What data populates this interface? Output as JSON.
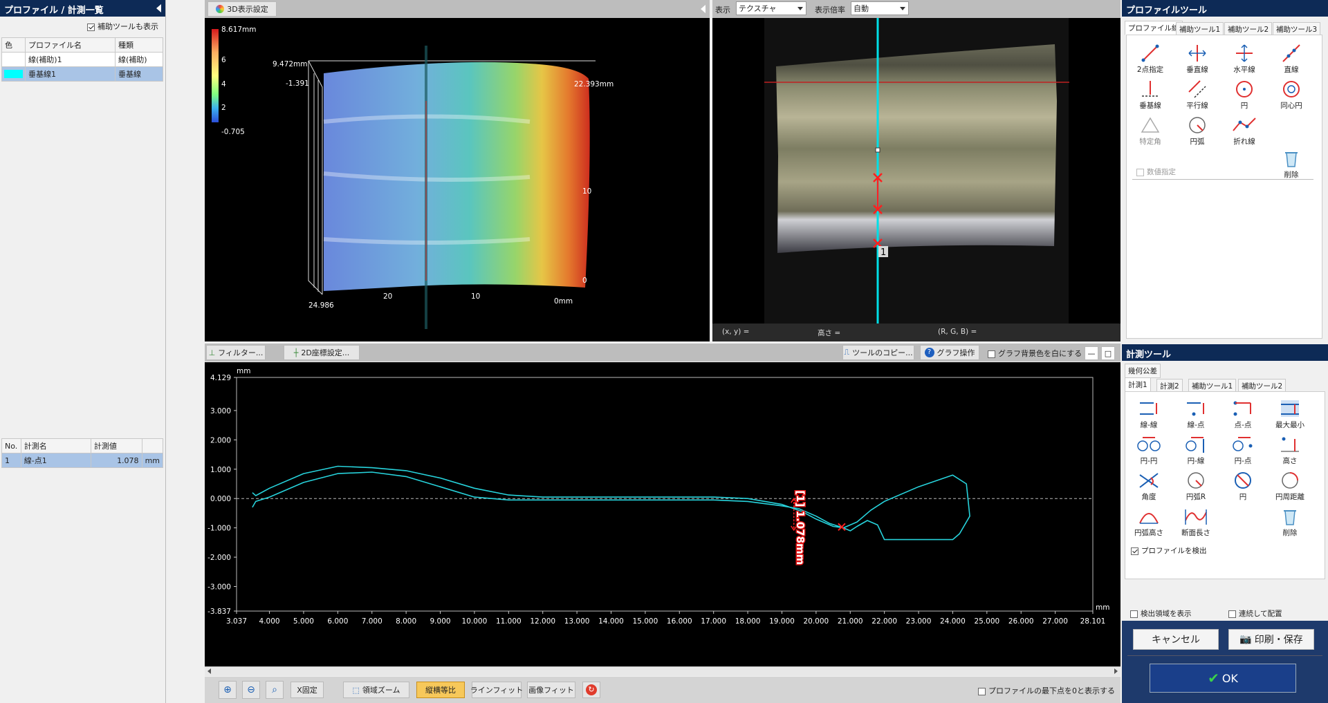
{
  "left_panel": {
    "title": "プロファイル / 計測一覧",
    "show_aux_label": "補助ツールも表示",
    "profile_table": {
      "headers": [
        "色",
        "プロファイル名",
        "種類"
      ],
      "rows": [
        {
          "color": "#ffffff",
          "name": "線(補助)1",
          "type": "線(補助)"
        },
        {
          "color": "#00ffff",
          "name": "垂基線1",
          "type": "垂基線"
        }
      ]
    },
    "measure_table": {
      "headers": [
        "No.",
        "計測名",
        "計測値",
        ""
      ],
      "rows": [
        {
          "no": "1",
          "name": "線-点1",
          "value": "1.078",
          "unit": "mm"
        }
      ]
    }
  },
  "view3d": {
    "button": "3D表示設定",
    "colorbar": {
      "max": "8.617mm",
      "ticks": [
        "6",
        "4",
        "2"
      ],
      "min": "-0.705"
    },
    "labels": {
      "top_left": "9.472mm",
      "minus": "-1.391",
      "right": "22.393mm",
      "bottom_left": "24.986",
      "x20": "20",
      "x10": "10",
      "x0": "0mm",
      "side10": "10",
      "side0": "0"
    }
  },
  "view2d": {
    "display_label": "表示",
    "display_value": "テクスチャ",
    "zoom_label": "表示倍率",
    "zoom_value": "自動",
    "marker_label": "1",
    "status": {
      "xy": "(x, y)  =",
      "height": "高さ  =",
      "rgb": "(R, G, B)  ="
    }
  },
  "graph_toolbar": {
    "filter": "フィルター...",
    "coord": "2D座標設定...",
    "copy_tool": "ツールのコピー...",
    "graph_op": "グラフ操作",
    "white_bg": "グラフ背景色を白にする"
  },
  "chart_data": {
    "type": "line",
    "yunit": "mm",
    "xunit": "mm",
    "xlim": [
      3.037,
      28.101
    ],
    "ylim": [
      -3.837,
      4.129
    ],
    "x_ticks": [
      "3.037",
      "4.000",
      "5.000",
      "6.000",
      "7.000",
      "8.000",
      "9.000",
      "10.000",
      "11.000",
      "12.000",
      "13.000",
      "14.000",
      "15.000",
      "16.000",
      "17.000",
      "18.000",
      "19.000",
      "20.000",
      "21.000",
      "22.000",
      "23.000",
      "24.000",
      "25.000",
      "26.000",
      "27.000",
      "28.101"
    ],
    "y_ticks": [
      "4.129",
      "3.000",
      "2.000",
      "1.000",
      "0.000",
      "-1.000",
      "-2.000",
      "-3.000",
      "-3.837"
    ],
    "series": [
      {
        "x": [
          3.5,
          3.6,
          4.0,
          5.0,
          6.0,
          7.0,
          8.0,
          9.0,
          10.0,
          11.0,
          12.0,
          13.0,
          14.0,
          15.0,
          16.0,
          17.0,
          18.0,
          19.0,
          19.6,
          20.0,
          20.5,
          20.8,
          21.2,
          21.6,
          22.0,
          23.0,
          24.0,
          24.4,
          24.5,
          24.2,
          24.0,
          23.0,
          22.0,
          21.8,
          21.5,
          21.2,
          21.0,
          20.8,
          20.4,
          20.0,
          19.5,
          19.0,
          18.0,
          17.0,
          16.0,
          15.0,
          14.0,
          13.0,
          12.0,
          11.0,
          10.0,
          9.0,
          8.0,
          7.0,
          6.0,
          5.0,
          4.0,
          3.6,
          3.5
        ],
        "y": [
          0.2,
          0.1,
          0.35,
          0.85,
          1.1,
          1.05,
          0.95,
          0.7,
          0.35,
          0.12,
          0.05,
          0.05,
          0.05,
          0.05,
          0.05,
          0.05,
          0.0,
          -0.2,
          -0.45,
          -0.7,
          -0.95,
          -1.0,
          -0.8,
          -0.4,
          -0.1,
          0.4,
          0.8,
          0.5,
          -0.6,
          -1.2,
          -1.4,
          -1.4,
          -1.4,
          -0.9,
          -0.75,
          -0.95,
          -1.1,
          -1.0,
          -0.85,
          -0.6,
          -0.35,
          -0.25,
          -0.1,
          -0.05,
          -0.05,
          -0.05,
          -0.05,
          -0.05,
          -0.05,
          -0.05,
          0.05,
          0.4,
          0.75,
          0.9,
          0.85,
          0.55,
          0.05,
          -0.1,
          -0.3
        ]
      }
    ],
    "annotation": "[1] 1.078mm"
  },
  "bottom_toolbar": {
    "x_fix": "X固定",
    "area_zoom": "領域ズーム",
    "aspect": "縦横等比",
    "line_fit": "ラインフィット",
    "image_fit": "画像フィット",
    "min_zero": "プロファイルの最下点を0と表示する"
  },
  "profile_tools": {
    "title": "プロファイルツール",
    "tabs": [
      "プロファイル線",
      "補助ツール1",
      "補助ツール2",
      "補助ツール3"
    ],
    "items": [
      "2点指定",
      "垂直線",
      "水平線",
      "直線",
      "垂基線",
      "平行線",
      "円",
      "同心円",
      "特定角",
      "円弧",
      "折れ線"
    ],
    "delete": "削除",
    "numeric": "数値指定"
  },
  "measure_tools": {
    "title": "計測ツール",
    "top_tab": "幾何公差",
    "tabs": [
      "計測1",
      "計測2",
      "補助ツール1",
      "補助ツール2"
    ],
    "items": [
      "線-線",
      "線-点",
      "点-点",
      "最大最小",
      "円-円",
      "円-線",
      "円-点",
      "高さ",
      "角度",
      "円弧R",
      "円",
      "円周距離",
      "円弧高さ",
      "断面長さ"
    ],
    "delete": "削除",
    "detect_profile": "プロファイルを検出",
    "show_area": "検出領域を表示",
    "continuous": "連続して配置"
  },
  "footer": {
    "cancel": "キャンセル",
    "print": "印刷・保存",
    "ok": "OK"
  }
}
